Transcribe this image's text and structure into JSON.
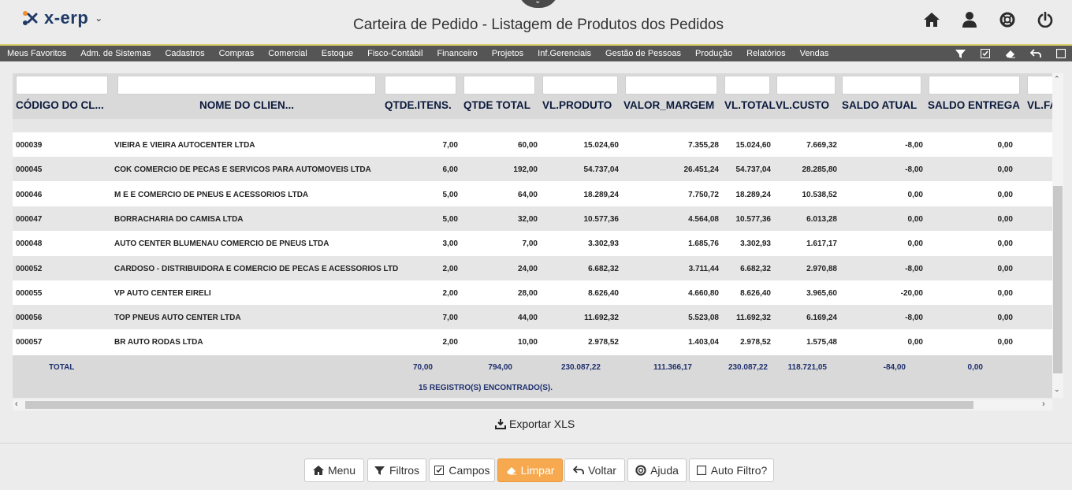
{
  "app": {
    "logo_text": "x-erp",
    "title": "Carteira de Pedido - Listagem de Produtos dos Pedidos"
  },
  "top_icons": [
    "home-icon",
    "user-icon",
    "help-lifebuoy-icon",
    "power-icon"
  ],
  "menu": {
    "items": [
      "Meus Favoritos",
      "Adm. de Sistemas",
      "Cadastros",
      "Compras",
      "Comercial",
      "Estoque",
      "Fisco-Contábil",
      "Financeiro",
      "Projetos",
      "Inf.Gerenciais",
      "Gestão de Pessoas",
      "Produção",
      "Relatórios",
      "Vendas"
    ],
    "tools": [
      "filter-icon",
      "checkbox-icon",
      "eraser-icon",
      "undo-icon",
      "square-icon"
    ]
  },
  "grid": {
    "columns": [
      "CÓDIGO DO CL...",
      "NOME DO CLIEN...",
      "QTDE.ITENS.",
      "QTDE TOTAL",
      "VL.PRODUTO",
      "VALOR_MARGEM",
      "VL.TOTAL",
      "VL.CUSTO",
      "SALDO ATUAL",
      "SALDO ENTREGA",
      "VL.FA"
    ],
    "rows": [
      {
        "codigo": "000039",
        "nome": "VIEIRA E VIEIRA AUTOCENTER LTDA",
        "qtde_itens": "7,00",
        "qtde_total": "60,00",
        "vl_produto": "15.024,60",
        "valor_margem": "7.355,28",
        "vl_total": "15.024,60",
        "vl_custo": "7.669,32",
        "saldo_atual": "-8,00",
        "saldo_entrega": "0,00"
      },
      {
        "codigo": "000045",
        "nome": "COK COMERCIO DE PECAS E SERVICOS PARA AUTOMOVEIS LTDA",
        "qtde_itens": "6,00",
        "qtde_total": "192,00",
        "vl_produto": "54.737,04",
        "valor_margem": "26.451,24",
        "vl_total": "54.737,04",
        "vl_custo": "28.285,80",
        "saldo_atual": "-8,00",
        "saldo_entrega": "0,00"
      },
      {
        "codigo": "000046",
        "nome": "M E E COMERCIO DE PNEUS E ACESSORIOS LTDA",
        "qtde_itens": "5,00",
        "qtde_total": "64,00",
        "vl_produto": "18.289,24",
        "valor_margem": "7.750,72",
        "vl_total": "18.289,24",
        "vl_custo": "10.538,52",
        "saldo_atual": "0,00",
        "saldo_entrega": "0,00"
      },
      {
        "codigo": "000047",
        "nome": "BORRACHARIA DO CAMISA LTDA",
        "qtde_itens": "5,00",
        "qtde_total": "32,00",
        "vl_produto": "10.577,36",
        "valor_margem": "4.564,08",
        "vl_total": "10.577,36",
        "vl_custo": "6.013,28",
        "saldo_atual": "0,00",
        "saldo_entrega": "0,00"
      },
      {
        "codigo": "000048",
        "nome": "AUTO CENTER BLUMENAU COMERCIO DE PNEUS LTDA",
        "qtde_itens": "3,00",
        "qtde_total": "7,00",
        "vl_produto": "3.302,93",
        "valor_margem": "1.685,76",
        "vl_total": "3.302,93",
        "vl_custo": "1.617,17",
        "saldo_atual": "0,00",
        "saldo_entrega": "0,00"
      },
      {
        "codigo": "000052",
        "nome": "CARDOSO - DISTRIBUIDORA E COMERCIO DE PECAS E ACESSORIOS LTD",
        "qtde_itens": "2,00",
        "qtde_total": "24,00",
        "vl_produto": "6.682,32",
        "valor_margem": "3.711,44",
        "vl_total": "6.682,32",
        "vl_custo": "2.970,88",
        "saldo_atual": "-8,00",
        "saldo_entrega": "0,00"
      },
      {
        "codigo": "000055",
        "nome": "VP AUTO CENTER EIRELI",
        "qtde_itens": "2,00",
        "qtde_total": "28,00",
        "vl_produto": "8.626,40",
        "valor_margem": "4.660,80",
        "vl_total": "8.626,40",
        "vl_custo": "3.965,60",
        "saldo_atual": "-20,00",
        "saldo_entrega": "0,00"
      },
      {
        "codigo": "000056",
        "nome": "TOP PNEUS AUTO CENTER LTDA",
        "qtde_itens": "7,00",
        "qtde_total": "44,00",
        "vl_produto": "11.692,32",
        "valor_margem": "5.523,08",
        "vl_total": "11.692,32",
        "vl_custo": "6.169,24",
        "saldo_atual": "-8,00",
        "saldo_entrega": "0,00"
      },
      {
        "codigo": "000057",
        "nome": "BR AUTO RODAS LTDA",
        "qtde_itens": "2,00",
        "qtde_total": "10,00",
        "vl_produto": "2.978,52",
        "valor_margem": "1.403,04",
        "vl_total": "2.978,52",
        "vl_custo": "1.575,48",
        "saldo_atual": "0,00",
        "saldo_entrega": "0,00"
      }
    ],
    "total": {
      "label": "TOTAL",
      "qtde_itens": "70,00",
      "qtde_total": "794,00",
      "vl_produto": "230.087,22",
      "valor_margem": "111.366,17",
      "vl_total": "230.087,22",
      "vl_custo": "118.721,05",
      "saldo_atual": "-84,00",
      "saldo_entrega": "0,00"
    },
    "registros": "15 REGISTRO(S) ENCONTRADO(S)."
  },
  "export_label": "Exportar XLS",
  "footer_buttons": {
    "menu": "Menu",
    "filtros": "Filtros",
    "campos": "Campos",
    "limpar": "Limpar",
    "voltar": "Voltar",
    "ajuda": "Ajuda",
    "auto_filtro": "Auto Filtro?"
  },
  "colors": {
    "accent": "#f6a94e",
    "menubar": "#555555",
    "header_text": "#0c1a3d",
    "total_text": "#1e2f6e"
  }
}
